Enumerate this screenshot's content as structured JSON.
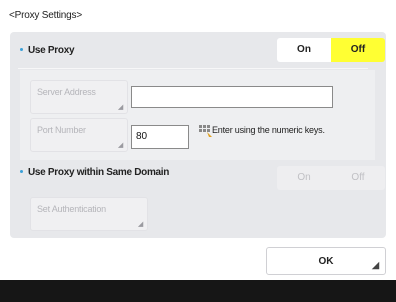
{
  "page_title": "<Proxy Settings>",
  "use_proxy": {
    "label": "Use Proxy",
    "on_label": "On",
    "off_label": "Off",
    "selected": "Off"
  },
  "server_address": {
    "label": "Server Address",
    "value": ""
  },
  "port_number": {
    "label": "Port Number",
    "value": "80",
    "hint": "Enter using the numeric keys.",
    "hint_icon": "keypad-icon"
  },
  "same_domain": {
    "label": "Use Proxy within Same Domain",
    "on_label": "On",
    "off_label": "Off"
  },
  "set_authentication": {
    "label": "Set Authentication"
  },
  "ok_button": {
    "label": "OK"
  },
  "colors": {
    "selected_yellow": "#ffff33",
    "panel_bg": "#e7e8eb",
    "bullet_blue": "#3aa0d8",
    "footer_bar": "#161616"
  }
}
